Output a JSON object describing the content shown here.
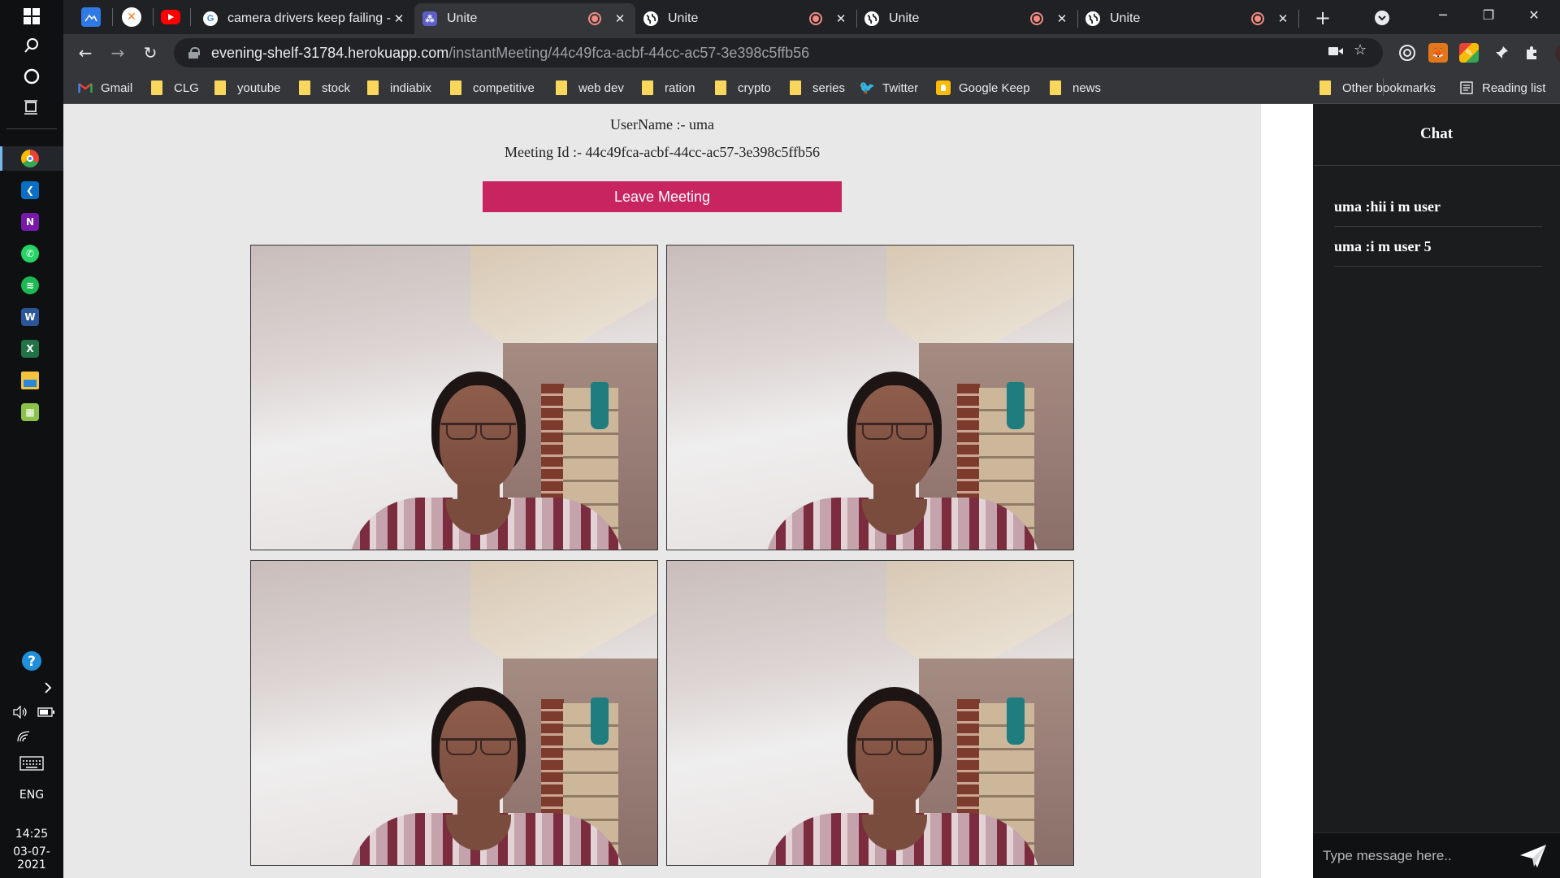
{
  "colors": {
    "accent": "#c8245f",
    "chat_bg": "#1b1c1d",
    "page_bg": "#e8e8e8",
    "browser_bg": "#202124"
  },
  "browser": {
    "tabs": [
      {
        "title": "camera drivers keep failing -",
        "icon": "google-icon"
      },
      {
        "title": "Unite",
        "icon": "teams-icon"
      },
      {
        "title": "Unite",
        "icon": "globe-icon"
      },
      {
        "title": "Unite",
        "icon": "globe-icon"
      },
      {
        "title": "Unite",
        "icon": "globe-icon"
      }
    ],
    "url": {
      "host": "evening-shelf-31784.herokuapp.com",
      "path": "/instantMeeting/44c49fca-acbf-44cc-ac57-3e398c5ffb56"
    },
    "bookmarks": [
      "Gmail",
      "CLG",
      "youtube",
      "stock",
      "indiabix",
      "competitive",
      "web dev",
      "ration",
      "crypto",
      "series",
      "Twitter",
      "Google Keep",
      "news"
    ],
    "other_bookmarks": "Other bookmarks",
    "reading_list": "Reading list"
  },
  "taskbar": {
    "language": "ENG",
    "time": "14:25",
    "date": "03-07-2021"
  },
  "meeting": {
    "username_line": "UserName :- uma",
    "meeting_id_line": "Meeting Id :- 44c49fca-acbf-44cc-ac57-3e398c5ffb56",
    "leave_button": "Leave Meeting",
    "video_count": 4
  },
  "chat": {
    "title": "Chat",
    "messages": [
      "uma :hii i m user",
      "uma :i m user 5"
    ],
    "input_placeholder": "Type message here.."
  }
}
